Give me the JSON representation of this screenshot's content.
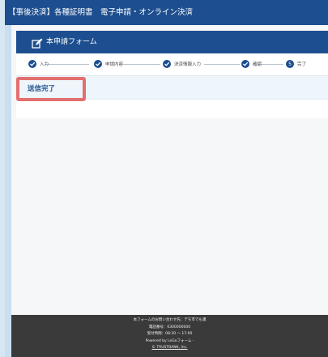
{
  "window": {
    "title": "【事後決済】各種証明書　電子申請・オンライン決済"
  },
  "card": {
    "title": "本申請フォーム",
    "icon": "edit-icon"
  },
  "steps": [
    {
      "label": "入力",
      "state": "done"
    },
    {
      "label": "申請内容",
      "state": "done"
    },
    {
      "label": "決済情報入力",
      "state": "done"
    },
    {
      "label": "確認",
      "state": "done"
    },
    {
      "label": "完了",
      "state": "current",
      "number": "5"
    }
  ],
  "status": {
    "message": "送信完了"
  },
  "footer": {
    "inquiry": "本フォームのお問い合わせ先：デモ市でも課",
    "phone": "電話番号：0300000000",
    "hours": "受付時間：08:30 ～ 17:00",
    "powered_by": "Powered by LoGoフォーム -",
    "copyright": "© TRUSTBANK, Inc."
  },
  "colors": {
    "brand": "#1d4e8f",
    "highlight": "#e36f6f",
    "footer_bg": "#3a3a3a"
  }
}
